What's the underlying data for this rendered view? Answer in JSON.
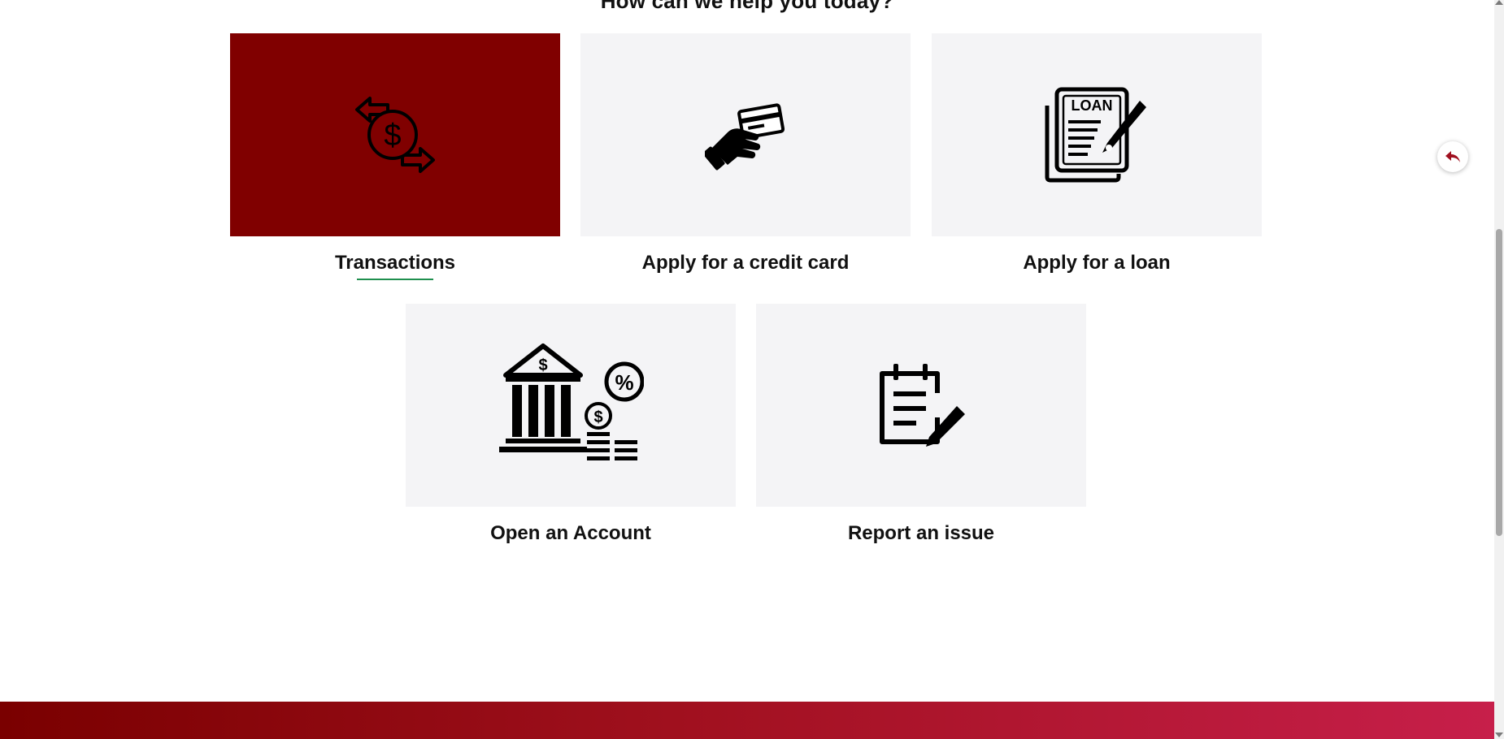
{
  "page": {
    "heading": "How can we help you today?"
  },
  "services": {
    "row1": [
      {
        "label": "Transactions",
        "icon": "transactions-icon",
        "active": true
      },
      {
        "label": "Apply for a credit card",
        "icon": "credit-card-icon",
        "active": false
      },
      {
        "label": "Apply for a loan",
        "icon": "loan-document-icon",
        "active": false,
        "icon_text": "LOAN"
      }
    ],
    "row2": [
      {
        "label": "Open an Account",
        "icon": "bank-account-icon",
        "active": false
      },
      {
        "label": "Report an issue",
        "icon": "clipboard-edit-icon",
        "active": false
      }
    ]
  },
  "back_button": {
    "icon": "reply-arrow-icon"
  },
  "colors": {
    "active_tile": "#800000",
    "tile": "#f4f4f6",
    "underline": "#1f8f4e",
    "footer_start": "#7a0000",
    "footer_end": "#c71f4a"
  }
}
